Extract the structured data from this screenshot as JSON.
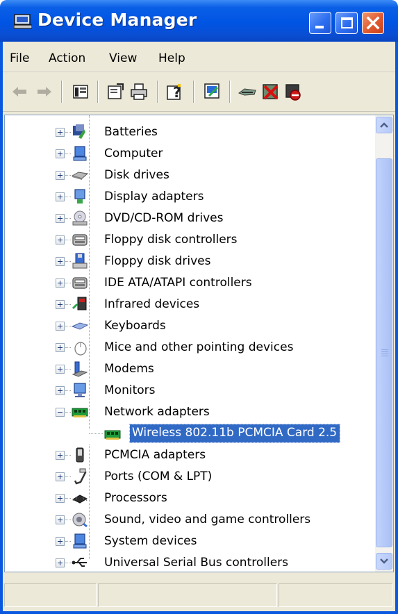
{
  "window": {
    "title": "Device Manager",
    "accent": "#0054e3",
    "close_color": "#e2592f"
  },
  "menu": {
    "file": "File",
    "action": "Action",
    "view": "View",
    "help": "Help"
  },
  "toolbar": {
    "icons": [
      "back-arrow-icon",
      "forward-arrow-icon",
      "show-hide-tree-icon",
      "properties-icon",
      "print-icon",
      "help-icon",
      "scan-hardware-icon",
      "update-driver-icon",
      "uninstall-icon",
      "disable-icon"
    ]
  },
  "tree": {
    "categories": [
      {
        "label": "Batteries",
        "icon": "battery-icon"
      },
      {
        "label": "Computer",
        "icon": "computer-icon"
      },
      {
        "label": "Disk drives",
        "icon": "disk-drive-icon"
      },
      {
        "label": "Display adapters",
        "icon": "display-adapter-icon"
      },
      {
        "label": "DVD/CD-ROM drives",
        "icon": "optical-drive-icon"
      },
      {
        "label": "Floppy disk controllers",
        "icon": "floppy-controller-icon"
      },
      {
        "label": "Floppy disk drives",
        "icon": "floppy-drive-icon"
      },
      {
        "label": "IDE ATA/ATAPI controllers",
        "icon": "ide-controller-icon"
      },
      {
        "label": "Infrared devices",
        "icon": "infrared-icon"
      },
      {
        "label": "Keyboards",
        "icon": "keyboard-icon"
      },
      {
        "label": "Mice and other pointing devices",
        "icon": "mouse-icon"
      },
      {
        "label": "Modems",
        "icon": "modem-icon"
      },
      {
        "label": "Monitors",
        "icon": "monitor-icon"
      },
      {
        "label": "Network adapters",
        "icon": "network-adapter-icon",
        "expanded": true
      },
      {
        "label": "PCMCIA adapters",
        "icon": "pcmcia-icon"
      },
      {
        "label": "Ports (COM & LPT)",
        "icon": "port-icon"
      },
      {
        "label": "Processors",
        "icon": "processor-icon"
      },
      {
        "label": "Sound, video and game controllers",
        "icon": "sound-icon"
      },
      {
        "label": "System devices",
        "icon": "system-device-icon"
      },
      {
        "label": "Universal Serial Bus controllers",
        "icon": "usb-icon"
      }
    ],
    "selected_device": {
      "label": "Wireless 802.11b PCMCIA Card 2.5",
      "icon": "network-card-icon",
      "highlight_color": "#316ac5"
    }
  }
}
